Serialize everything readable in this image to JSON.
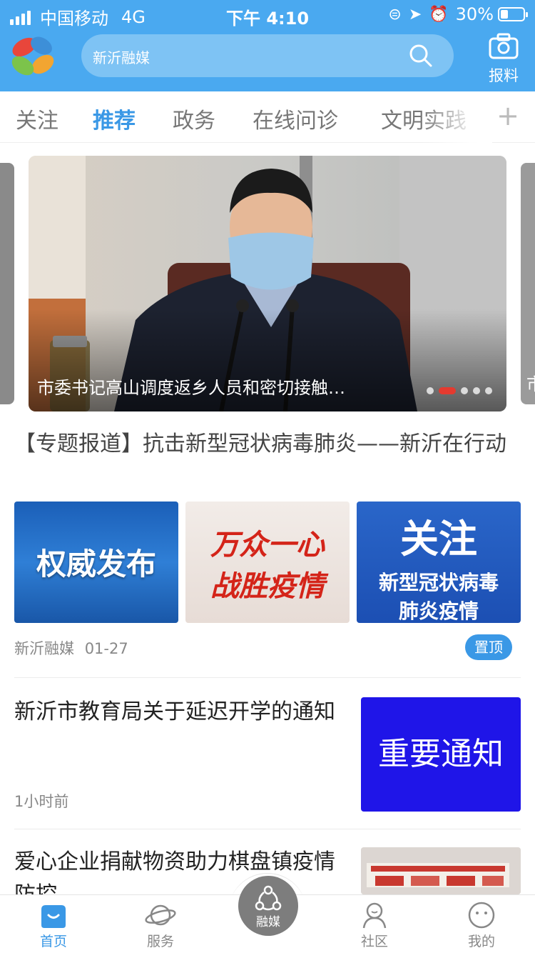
{
  "status_bar": {
    "carrier": "中国移动",
    "network": "4G",
    "time": "下午 4:10",
    "battery_percent": "30%",
    "battery_level": 0.3,
    "icons": [
      "signal-icon",
      "lock-rotation-icon",
      "location-icon",
      "alarm-icon",
      "battery-icon"
    ]
  },
  "header": {
    "logo": "app-logo",
    "search_placeholder": "新沂融媒",
    "report_label": "报料"
  },
  "tabs": [
    {
      "label": "关注",
      "active": false
    },
    {
      "label": "推荐",
      "active": true
    },
    {
      "label": "政务",
      "active": false
    },
    {
      "label": "在线问诊",
      "active": false
    },
    {
      "label": "文明实践",
      "active": false
    }
  ],
  "tabs_add": "+",
  "banner": {
    "caption": "市委书记高山调度返乡人员和密切接触…",
    "dot_count": 5,
    "active_dot": 1,
    "peek_right_text": "市"
  },
  "feature": {
    "title": "【专题报道】抗击新型冠状病毒肺炎——新沂在行动",
    "images": [
      {
        "text": "权威发布"
      },
      {
        "line1": "万众一心",
        "line2": "战胜疫情"
      },
      {
        "line1": "关注",
        "line2": "新型冠状病毒",
        "line3": "肺炎疫情"
      }
    ],
    "source": "新沂融媒",
    "date": "01-27",
    "badge": "置顶"
  },
  "news": [
    {
      "title": "新沂市教育局关于延迟开学的通知",
      "time": "1小时前",
      "thumb_text": "重要通知"
    },
    {
      "title": "爱心企业捐献物资助力棋盘镇疫情防控"
    }
  ],
  "bottom_nav": [
    {
      "label": "首页",
      "icon": "home-icon",
      "active": true
    },
    {
      "label": "服务",
      "icon": "planet-icon",
      "active": false
    },
    {
      "label": "融媒",
      "icon": "share-icon",
      "active": false
    },
    {
      "label": "社区",
      "icon": "community-icon",
      "active": false
    },
    {
      "label": "我的",
      "icon": "smile-icon",
      "active": false
    }
  ],
  "colors": {
    "header_bg": "#4aa9f0",
    "accent": "#3a98e6",
    "notice_blue": "#1f15e8",
    "dot_active": "#e43a2f"
  }
}
